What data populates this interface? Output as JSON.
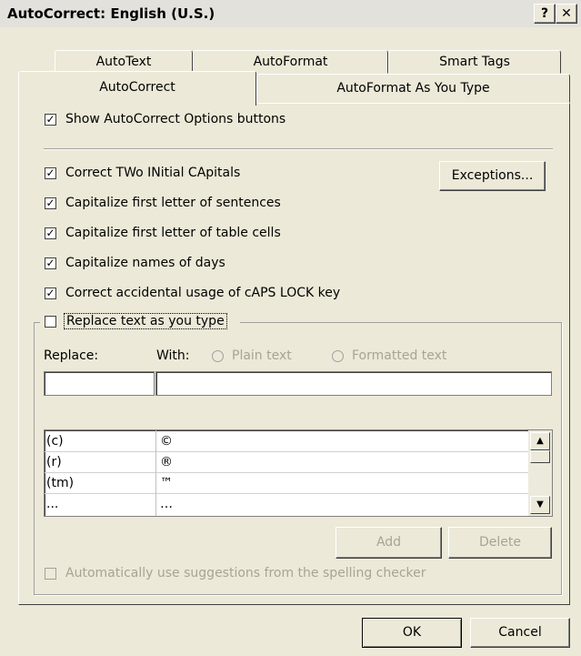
{
  "window": {
    "title": "AutoCorrect: English (U.S.)",
    "help_label": "?",
    "close_label": "✕"
  },
  "tabs": {
    "back": [
      "AutoText",
      "AutoFormat",
      "Smart Tags"
    ],
    "front": [
      "AutoCorrect",
      "AutoFormat As You Type"
    ]
  },
  "options": {
    "show_buttons": "Show AutoCorrect Options buttons",
    "correct_two_initial": "Correct TWo INitial CApitals",
    "capitalize_sentences": "Capitalize first letter of sentences",
    "capitalize_table_cells": "Capitalize first letter of table cells",
    "capitalize_days": "Capitalize names of days",
    "correct_caps_lock": "Correct accidental usage of cAPS LOCK key",
    "replace_text": "Replace text as you type",
    "auto_suggestions": "Automatically use suggestions from the spelling checker"
  },
  "check_mark": "✓",
  "buttons": {
    "exceptions": "Exceptions...",
    "add": "Add",
    "delete": "Delete",
    "ok": "OK",
    "cancel": "Cancel"
  },
  "replace_section": {
    "replace_label": "Replace:",
    "with_label": "With:",
    "plain_text": "Plain text",
    "formatted_text": "Formatted text",
    "replace_value": "",
    "with_value": ""
  },
  "entries": [
    {
      "replace": "(c)",
      "with": "©"
    },
    {
      "replace": "(r)",
      "with": "®"
    },
    {
      "replace": "(tm)",
      "with": "™"
    },
    {
      "replace": "...",
      "with": "…"
    }
  ],
  "scroll_arrows": {
    "up": "▲",
    "down": "▼"
  },
  "colors": {
    "dialog_bg": "#ece9d8",
    "disabled_text": "#a6a495"
  }
}
